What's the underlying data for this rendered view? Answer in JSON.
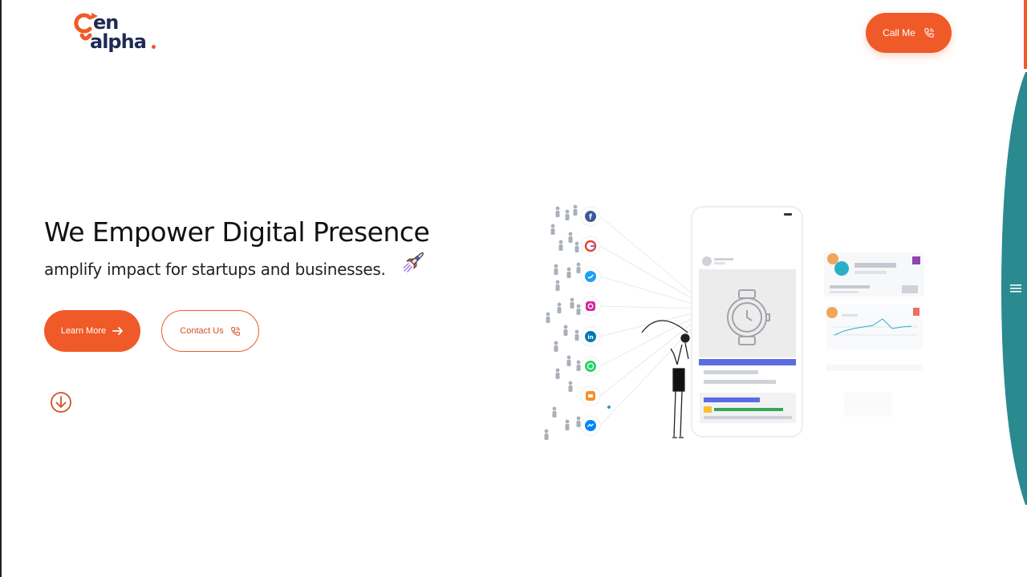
{
  "brand": {
    "logo_line1": "en",
    "logo_line2": "alpha",
    "primary_color": "#f05a28",
    "navy_color": "#1d2a55",
    "teal_color": "#2a8a8f"
  },
  "header": {
    "call_label": "Call Me",
    "call_icon": "phone-icon"
  },
  "hero": {
    "title": "We Empower Digital Presence",
    "subtitle": "amplify impact for startups and businesses.",
    "subtitle_icon": "rocket-icon",
    "learn_more_label": "Learn More",
    "learn_more_icon": "arrow-right-icon",
    "contact_label": "Contact Us",
    "contact_icon": "phone-icon",
    "scroll_icon": "arrow-down-circle-icon"
  },
  "illustration": {
    "social_icons": [
      "facebook-icon",
      "google-icon",
      "twitter-icon",
      "instagram-icon",
      "linkedin-icon",
      "whatsapp-icon",
      "blogger-icon",
      "messenger-icon"
    ]
  },
  "side_menu": {
    "icon": "hamburger-menu-icon"
  }
}
